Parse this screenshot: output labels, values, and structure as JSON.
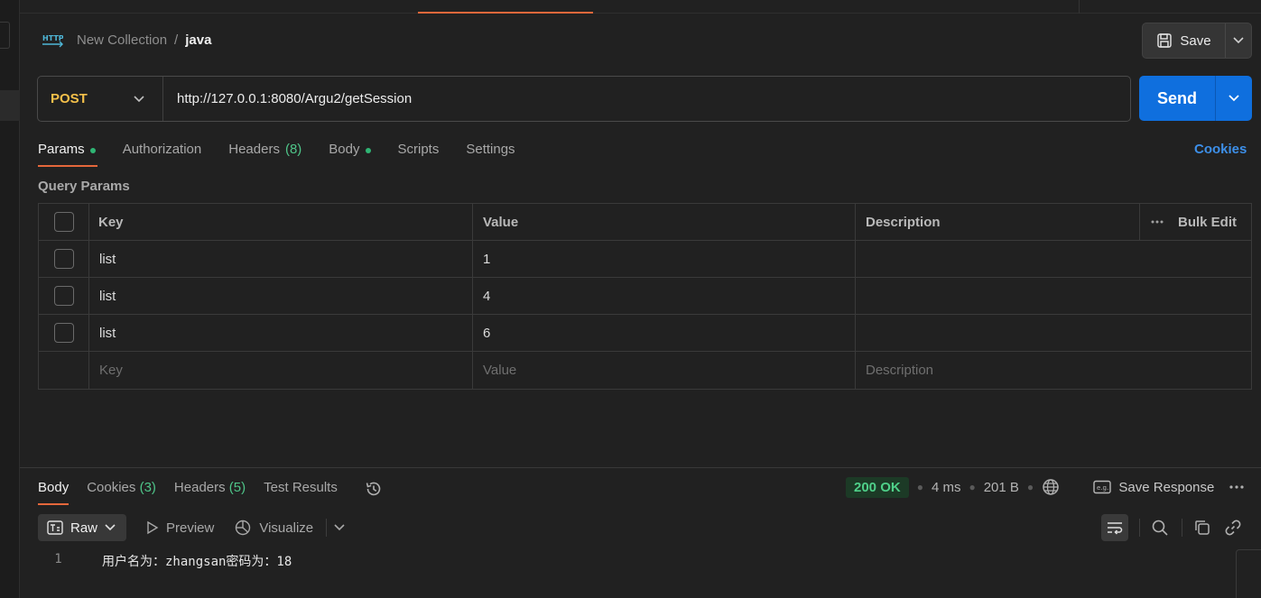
{
  "breadcrumb": {
    "parent": "New Collection",
    "separator": "/",
    "current": "java"
  },
  "header": {
    "save_label": "Save",
    "http_icon": "http-icon"
  },
  "request": {
    "method": "POST",
    "url": "http://127.0.0.1:8080/Argu2/getSession",
    "send_label": "Send"
  },
  "tabs": {
    "params": "Params",
    "authorization": "Authorization",
    "headers": "Headers",
    "headers_count": "(8)",
    "body": "Body",
    "scripts": "Scripts",
    "settings": "Settings",
    "cookies_link": "Cookies"
  },
  "params": {
    "title": "Query Params",
    "headers": {
      "key": "Key",
      "value": "Value",
      "description": "Description",
      "bulk_edit": "Bulk Edit"
    },
    "rows": [
      {
        "key": "list",
        "value": "1",
        "description": ""
      },
      {
        "key": "list",
        "value": "4",
        "description": ""
      },
      {
        "key": "list",
        "value": "6",
        "description": ""
      }
    ],
    "placeholder": {
      "key": "Key",
      "value": "Value",
      "description": "Description"
    }
  },
  "response": {
    "tabs": {
      "body": "Body",
      "cookies": "Cookies",
      "cookies_count": "(3)",
      "headers": "Headers",
      "headers_count": "(5)",
      "test_results": "Test Results"
    },
    "status": "200 OK",
    "time": "4 ms",
    "size": "201 B",
    "save_response": "Save Response",
    "toolbar": {
      "raw": "Raw",
      "preview": "Preview",
      "visualize": "Visualize"
    },
    "body_lines": [
      {
        "number": "1",
        "text": "用户名为：zhangsan密码为：18"
      }
    ]
  },
  "colors": {
    "accent": "#e5673b",
    "send": "#0f6fde",
    "method": "#f4c04a",
    "status_ok": "#4fd089",
    "link": "#3d8fe8"
  }
}
